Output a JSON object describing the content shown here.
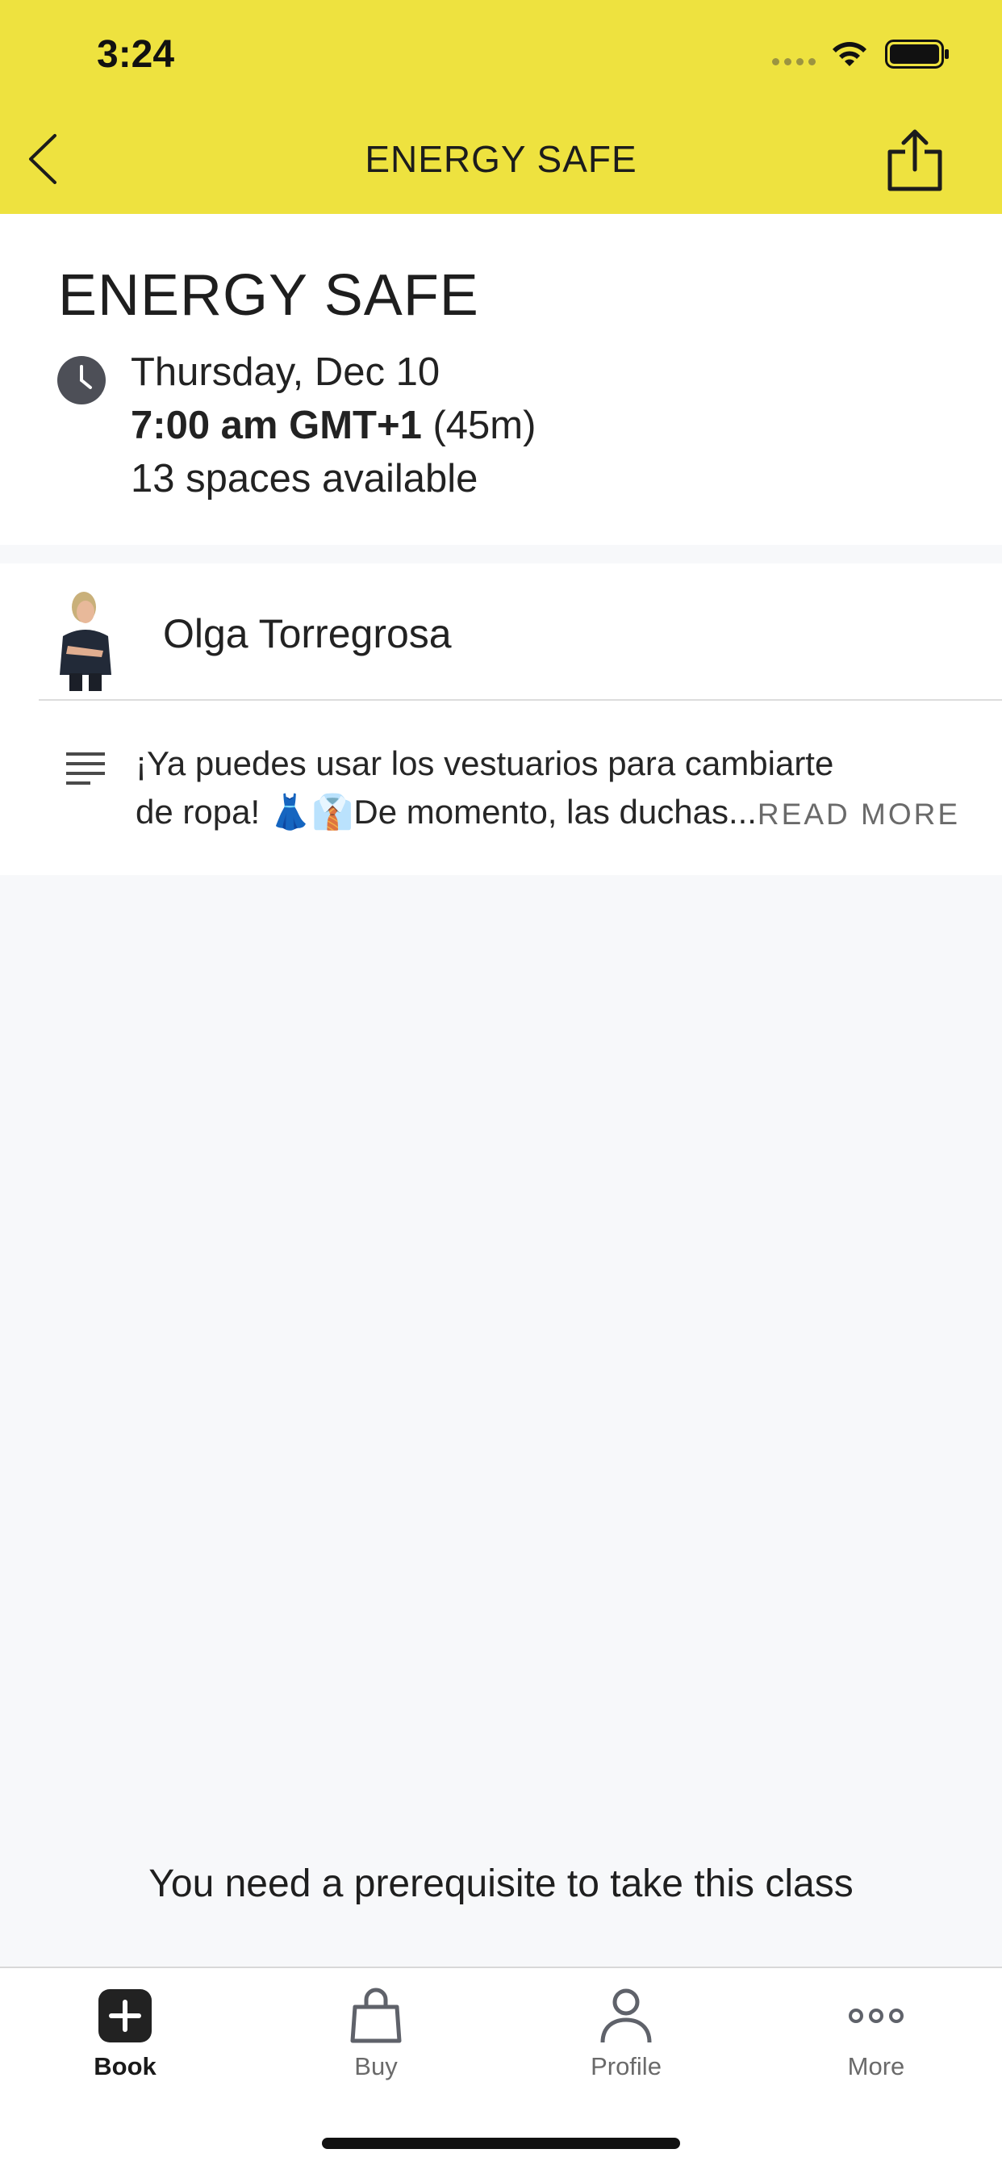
{
  "status_bar": {
    "time": "3:24"
  },
  "nav": {
    "title": "ENERGY SAFE"
  },
  "class_info": {
    "title": "ENERGY SAFE",
    "date": "Thursday, Dec 10",
    "time_bold": "7:00 am GMT+1",
    "duration": "(45m)",
    "spaces": "13 spaces available"
  },
  "instructor": {
    "name": "Olga Torregrosa"
  },
  "description": {
    "text": "¡Ya puedes usar los vestuarios para cambiarte de ropa! 👗👔De momento, las duchas...",
    "read_more": "READ MORE"
  },
  "prerequisite_message": "You need a prerequisite to take this class",
  "tabs": [
    {
      "label": "Book",
      "icon": "plus-square-icon",
      "active": true
    },
    {
      "label": "Buy",
      "icon": "shopping-bag-icon",
      "active": false
    },
    {
      "label": "Profile",
      "icon": "person-icon",
      "active": false
    },
    {
      "label": "More",
      "icon": "more-dots-icon",
      "active": false
    }
  ],
  "colors": {
    "header": "#eee23f",
    "background": "#f7f8fa",
    "card": "#ffffff"
  }
}
